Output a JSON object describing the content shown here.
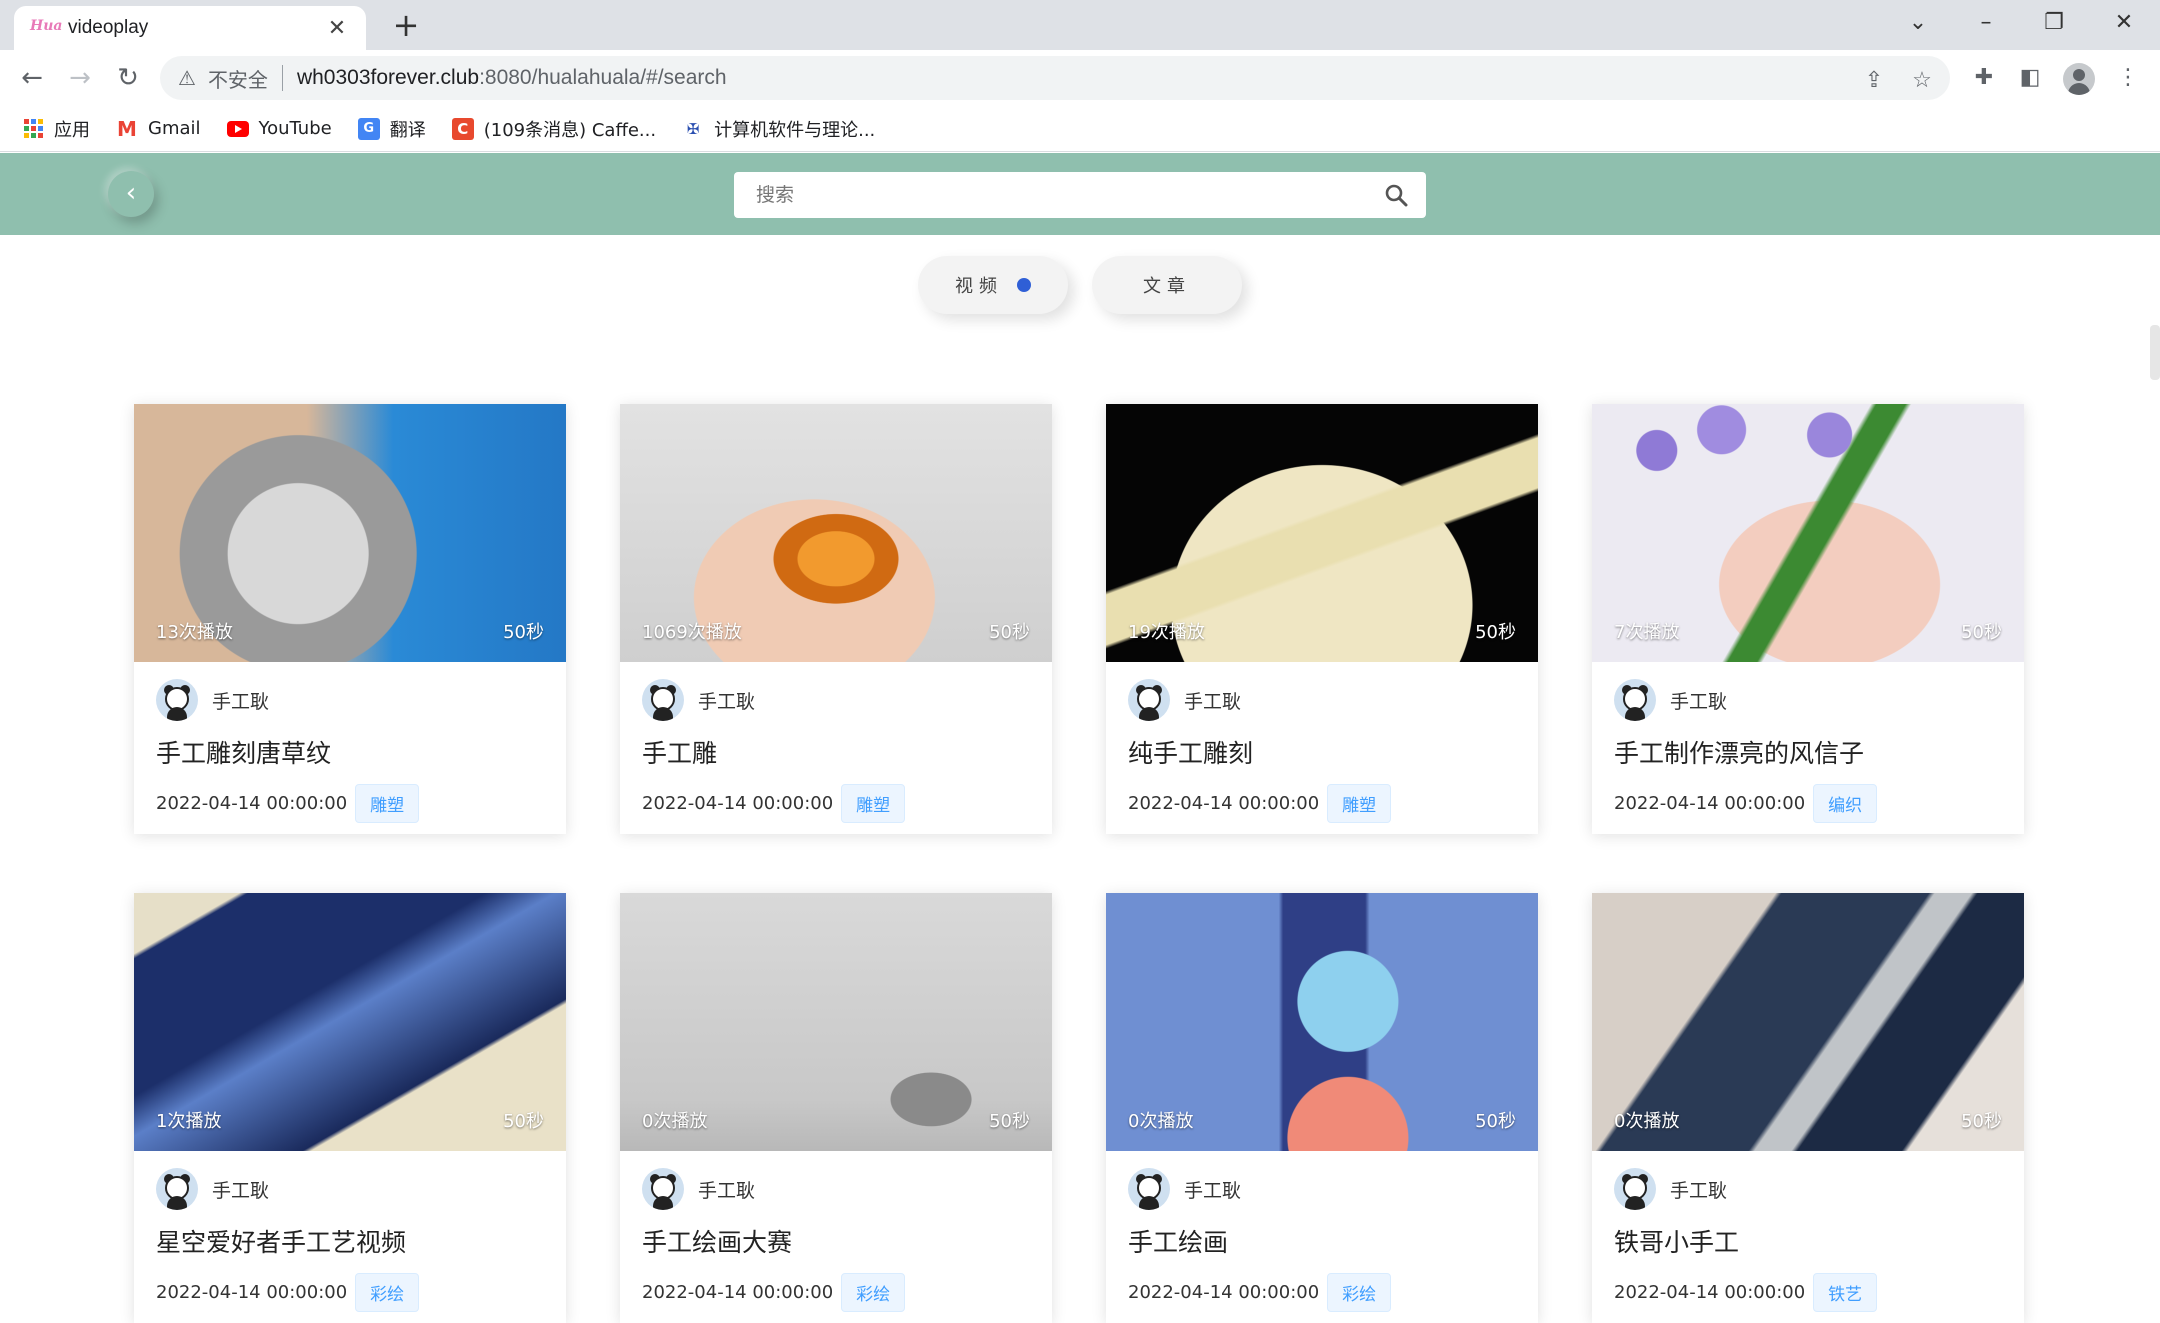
{
  "browser": {
    "tab_title": "videoplay",
    "tab_favicon": "Hua",
    "url_insecure_label": "不安全",
    "url_host": "wh0303forever.club",
    "url_path": ":8080/hualahuala/#/search",
    "bookmarks": [
      {
        "label": "应用",
        "icon": "apps-grid-icon"
      },
      {
        "label": "Gmail",
        "icon": "gmail-icon"
      },
      {
        "label": "YouTube",
        "icon": "youtube-icon"
      },
      {
        "label": "翻译",
        "icon": "translate-icon"
      },
      {
        "label": "(109条消息) Caffe...",
        "icon": "csdn-icon"
      },
      {
        "label": "计算机软件与理论...",
        "icon": "site-icon"
      }
    ]
  },
  "page": {
    "search_placeholder": "搜索",
    "tabs": [
      {
        "label": "视频",
        "active": true
      },
      {
        "label": "文章",
        "active": false
      }
    ],
    "accent_color": "#8fbfae",
    "videos": [
      {
        "views": "13次播放",
        "duration": "50秒",
        "author": "手工耿",
        "title": "手工雕刻唐草纹",
        "date": "2022-04-14 00:00:00",
        "tag": "雕塑",
        "thumb": "coin"
      },
      {
        "views": "1069次播放",
        "duration": "50秒",
        "author": "手工耿",
        "title": "手工雕",
        "date": "2022-04-14 00:00:00",
        "tag": "雕塑",
        "thumb": "amber"
      },
      {
        "views": "19次播放",
        "duration": "50秒",
        "author": "手工耿",
        "title": "纯手工雕刻",
        "date": "2022-04-14 00:00:00",
        "tag": "雕塑",
        "thumb": "jade"
      },
      {
        "views": "7次播放",
        "duration": "50秒",
        "author": "手工耿",
        "title": "手工制作漂亮的风信子",
        "date": "2022-04-14 00:00:00",
        "tag": "编织",
        "thumb": "flower"
      },
      {
        "views": "1次播放",
        "duration": "50秒",
        "author": "手工耿",
        "title": "星空爱好者手工艺视频",
        "date": "2022-04-14 00:00:00",
        "tag": "彩绘",
        "thumb": "galaxy"
      },
      {
        "views": "0次播放",
        "duration": "50秒",
        "author": "手工耿",
        "title": "手工绘画大赛",
        "date": "2022-04-14 00:00:00",
        "tag": "彩绘",
        "thumb": "ink"
      },
      {
        "views": "0次播放",
        "duration": "50秒",
        "author": "手工耿",
        "title": "手工绘画",
        "date": "2022-04-14 00:00:00",
        "tag": "彩绘",
        "thumb": "chopper"
      },
      {
        "views": "0次播放",
        "duration": "50秒",
        "author": "手工耿",
        "title": "铁哥小手工",
        "date": "2022-04-14 00:00:00",
        "tag": "铁艺",
        "thumb": "metal"
      }
    ]
  }
}
